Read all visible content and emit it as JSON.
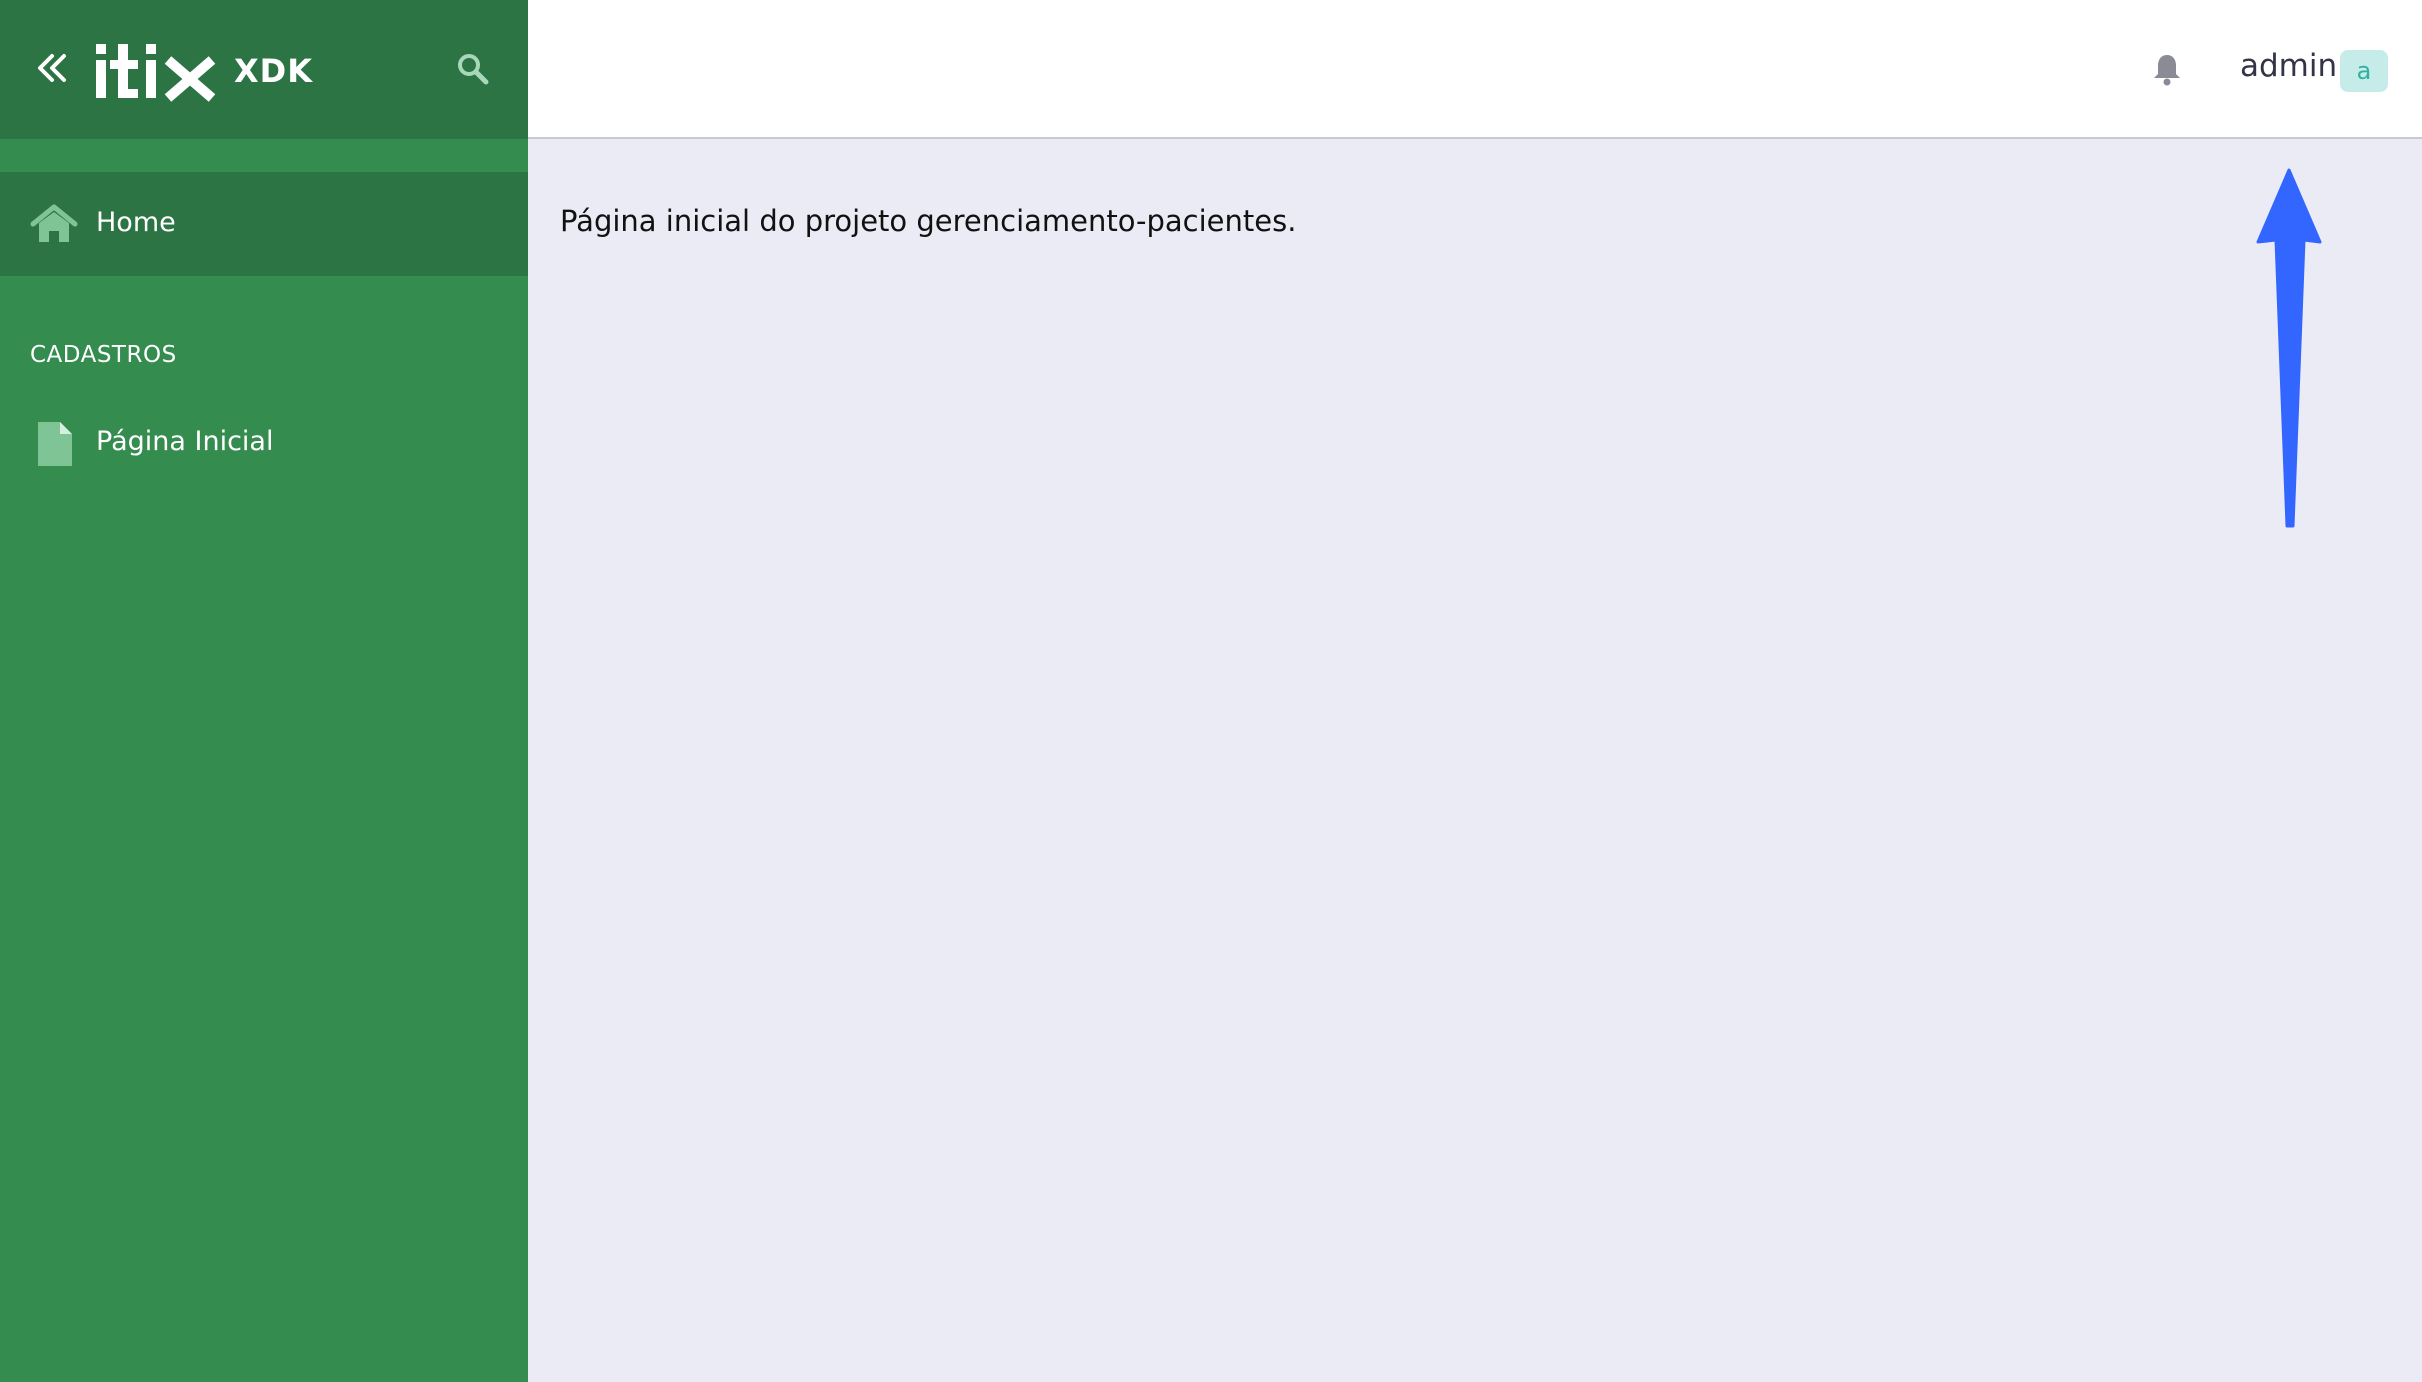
{
  "sidebar": {
    "brand_suffix": "XDK",
    "home_label": "Home",
    "section_title": "CADASTROS",
    "items": [
      {
        "label": "Página Inicial",
        "icon": "file-icon"
      }
    ]
  },
  "topbar": {
    "user_name": "admin",
    "avatar_initial": "a"
  },
  "main": {
    "text": "Página inicial do projeto gerenciamento-pacientes."
  },
  "colors": {
    "sidebar": "#358c4f",
    "sidebar_dark": "#2c7444",
    "content_bg": "#ebebf5",
    "avatar_bg": "#c5ece8",
    "avatar_fg": "#2fb0a1",
    "annotation_arrow": "#3366ff"
  }
}
